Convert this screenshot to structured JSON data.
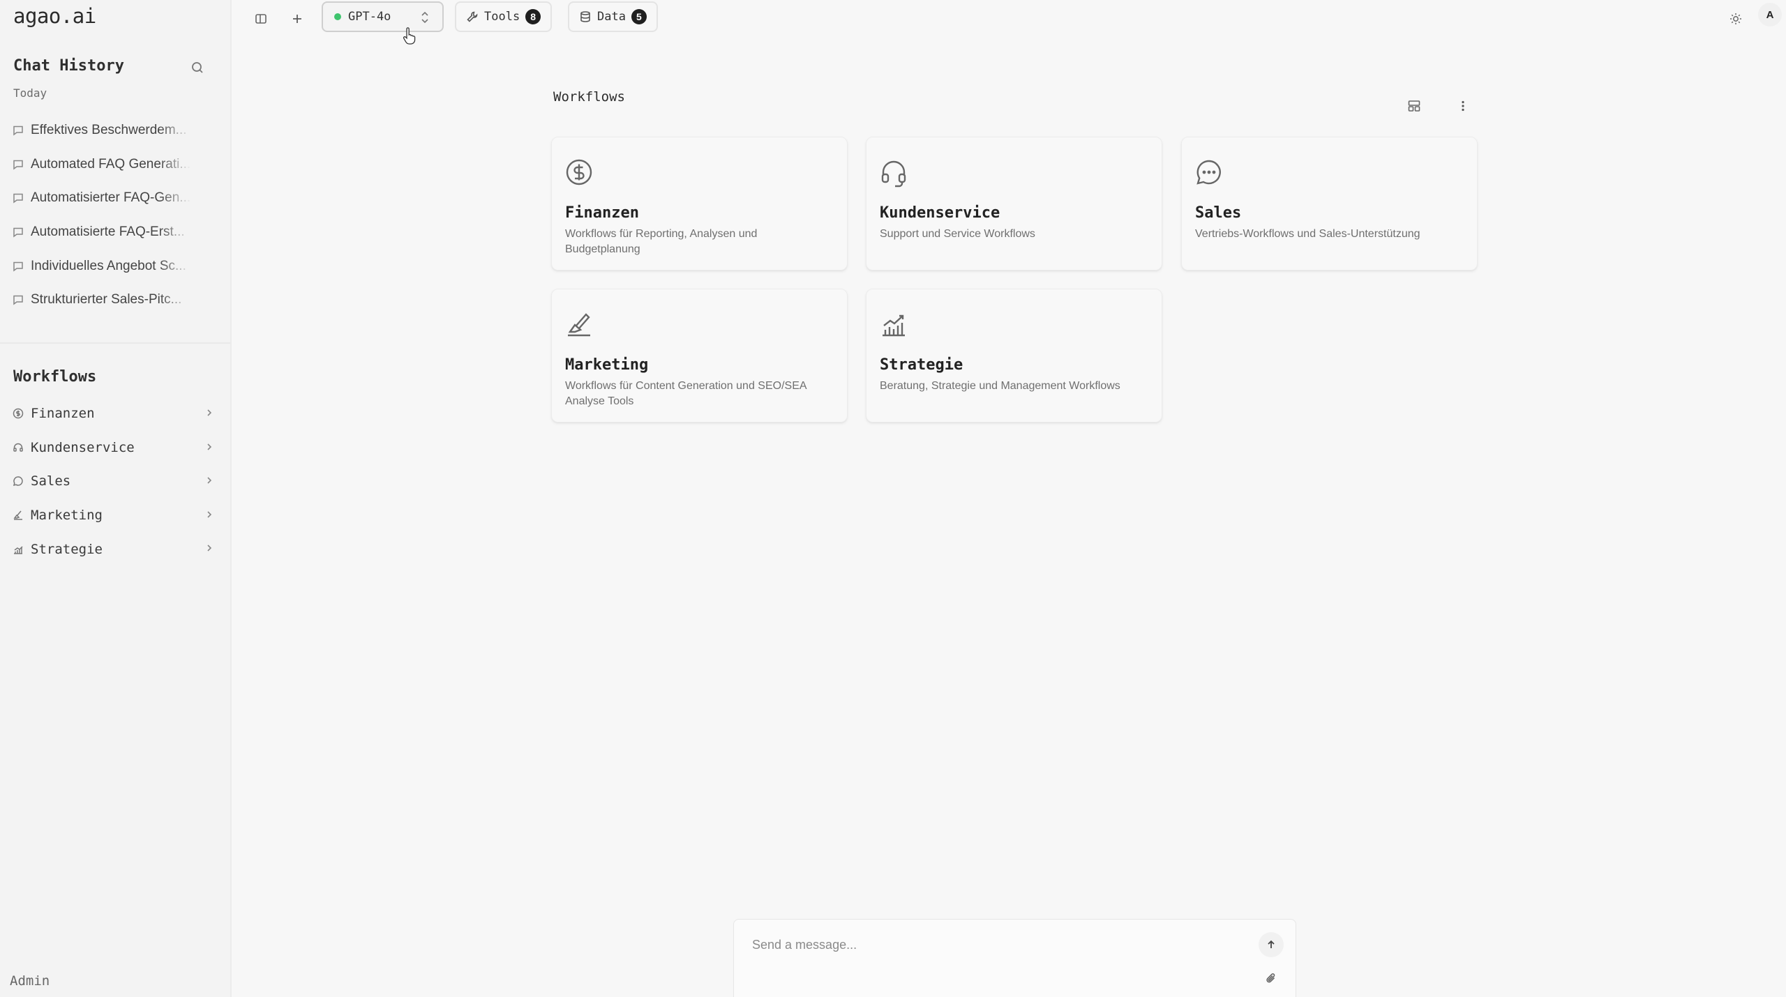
{
  "brand": "agao.ai",
  "sidebar": {
    "chat_history_title": "Chat History",
    "today_label": "Today",
    "history": [
      {
        "label": "Effektives Beschwerdem..."
      },
      {
        "label": "Automated FAQ Generati..."
      },
      {
        "label": "Automatisierter FAQ-Gen..."
      },
      {
        "label": "Automatisierte FAQ-Erst..."
      },
      {
        "label": "Individuelles Angebot Sc..."
      },
      {
        "label": "Strukturierter Sales-Pitc..."
      }
    ],
    "workflows_title": "Workflows",
    "workflows": [
      {
        "label": "Finanzen",
        "icon": "dollar-icon"
      },
      {
        "label": "Kundenservice",
        "icon": "headset-icon"
      },
      {
        "label": "Sales",
        "icon": "chat-bubble-icon"
      },
      {
        "label": "Marketing",
        "icon": "brush-icon"
      },
      {
        "label": "Strategie",
        "icon": "chart-icon"
      }
    ],
    "user_label": "Admin"
  },
  "topbar": {
    "model_name": "GPT-4o",
    "model_status_color": "#3ec46d",
    "tools_label": "Tools",
    "tools_count": "8",
    "data_label": "Data",
    "data_count": "5",
    "avatar_initial": "A"
  },
  "main": {
    "title": "Workflows",
    "cards": [
      {
        "title": "Finanzen",
        "desc": "Workflows für Reporting, Analysen und Budgetplanung",
        "icon": "dollar-icon"
      },
      {
        "title": "Kundenservice",
        "desc": "Support und Service Workflows",
        "icon": "headset-icon"
      },
      {
        "title": "Sales",
        "desc": "Vertriebs-Workflows und Sales-Unterstützung",
        "icon": "chat-bubble-icon"
      },
      {
        "title": "Marketing",
        "desc": "Workflows für Content Generation und SEO/SEA Analyse Tools",
        "icon": "brush-icon"
      },
      {
        "title": "Strategie",
        "desc": "Beratung, Strategie und Management Workflows",
        "icon": "chart-icon"
      }
    ]
  },
  "composer": {
    "placeholder": "Send a message..."
  }
}
